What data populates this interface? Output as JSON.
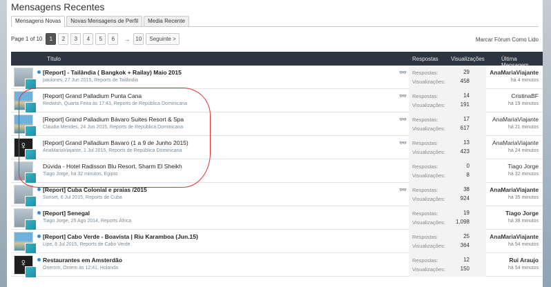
{
  "page": {
    "title": "Mensagens Recentes",
    "tabs": [
      {
        "label": "Mensagens Novas",
        "active": true
      },
      {
        "label": "Novas Mensagens de Perfil",
        "active": false
      },
      {
        "label": "Media Recente",
        "active": false
      }
    ]
  },
  "pager": {
    "info": "Page 1 of 10",
    "pages": [
      "1",
      "2",
      "3",
      "4",
      "5",
      "6"
    ],
    "current": "1",
    "arrow": "→",
    "last": "10",
    "next": "Seguinte >",
    "mark_read": "Marcar Fórum Como Lido"
  },
  "table": {
    "col_title": "Título",
    "col_replies": "Respostas",
    "col_views": "Visualizações",
    "col_last": "Última Mensagem",
    "replies_label": "Respostas:",
    "views_label": "Visualizações:",
    "rows": [
      {
        "title": "[Report] - Tailândia ( Bangkok + Railay) Maio 2015",
        "bold": true,
        "unread": true,
        "author": "paulonev",
        "date": "27 Jun 2015",
        "forum": "Reports de Tailândia",
        "replies": "29",
        "views": "458",
        "last_user": "AnaMariaViajante",
        "last_bold": true,
        "last_time": "há 4 minutos",
        "watch": true,
        "avatar": "person"
      },
      {
        "title": "[Report] Grand Palladium Punta Cana",
        "bold": false,
        "unread": false,
        "author": "Redwish",
        "date": "Quarta Feira às 17:43",
        "forum": "Reports de República Dominicana",
        "replies": "14",
        "views": "191",
        "last_user": "CristinaBF",
        "last_bold": false,
        "last_time": "há 19 minutos",
        "watch": true,
        "avatar": "beach"
      },
      {
        "title": "[Report] Grand Palladium Bávaro Suites Resort & Spa",
        "bold": false,
        "unread": false,
        "author": "Cláudia Mendes",
        "date": "24 Jun 2015",
        "forum": "Reports de República Dominicana",
        "replies": "17",
        "views": "617",
        "last_user": "AnaMariaViajante",
        "last_bold": false,
        "last_time": "há 21 minutos",
        "watch": true,
        "avatar": "beach"
      },
      {
        "title": "[Report] Grand Palladium Bavaro (1 a 9 de Junho 2015)",
        "bold": false,
        "unread": false,
        "author": "AnaMariaViajante",
        "date": "1 Jul 2015",
        "forum": "Reports de República Dominicana",
        "replies": "13",
        "views": "423",
        "last_user": "AnaMariaViajante",
        "last_bold": false,
        "last_time": "há 24 minutos",
        "watch": true,
        "avatar": "dark"
      },
      {
        "title": "Dúvida - Hotel Radisson Blu Resort, Sharm El Sheikh",
        "bold": false,
        "unread": false,
        "author": "Tiago Jorge",
        "date": "há 32 minutos",
        "forum": "Egipto",
        "replies": "0",
        "views": "8",
        "last_user": "Tiago Jorge",
        "last_bold": false,
        "last_time": "há 32 minutos",
        "watch": false,
        "avatar": "person"
      },
      {
        "title": "[Report] Cuba Colonial e praias /2015",
        "bold": true,
        "unread": true,
        "author": "Sunset",
        "date": "6 Jul 2015",
        "forum": "Reports de Cuba",
        "replies": "38",
        "views": "924",
        "last_user": "AnaMariaViajante",
        "last_bold": true,
        "last_time": "há 35 minutos",
        "watch": true,
        "avatar": "person"
      },
      {
        "title": "[Report] Senegal",
        "bold": true,
        "unread": true,
        "author": "Tiago Jorge",
        "date": "25 Ago 2014",
        "forum": "Reports África",
        "replies": "19",
        "views": "1,098",
        "last_user": "Tiago Jorge",
        "last_bold": true,
        "last_time": "há 38 minutos",
        "watch": false,
        "avatar": "person"
      },
      {
        "title": "[Report] Cabo Verde - Boavista | Riu Karamboa (Jun.15)",
        "bold": true,
        "unread": true,
        "author": "Lipe",
        "date": "8 Jul 2015",
        "forum": "Reports de Cabo Verde",
        "replies": "25",
        "views": "364",
        "last_user": "AnaMariaViajante",
        "last_bold": true,
        "last_time": "há 54 minutos",
        "watch": false,
        "avatar": "beach"
      },
      {
        "title": "Restaurantes em Amsterdão",
        "bold": true,
        "unread": true,
        "author": "Onerom",
        "date": "Ontem às 12:41",
        "forum": "Holanda",
        "replies": "12",
        "views": "150",
        "last_user": "Rui Araujo",
        "last_bold": true,
        "last_time": "há 54 minutos",
        "watch": false,
        "avatar": "dark"
      }
    ]
  }
}
